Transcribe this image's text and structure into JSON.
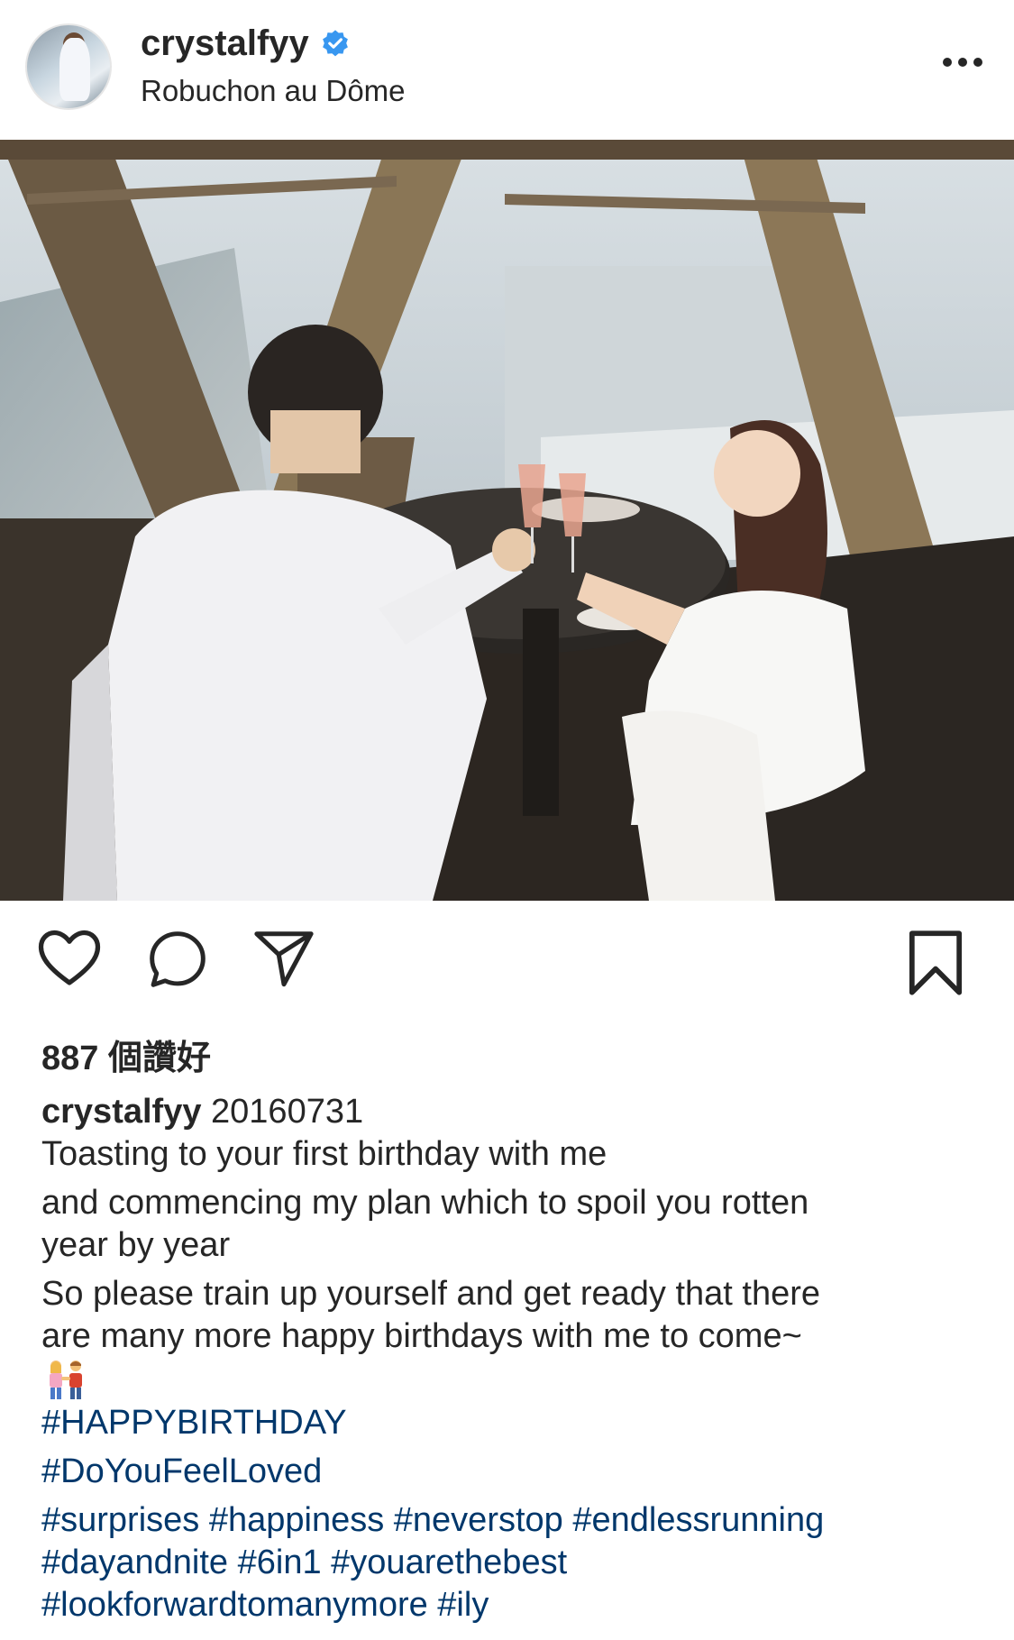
{
  "post": {
    "username": "crystalfyy",
    "location": "Robuchon au Dôme",
    "likes_text": "887 個讚好",
    "caption": {
      "username": "crystalfyy",
      "date": "20160731",
      "line1": "Toasting to your first birthday with me",
      "line2": "and commencing my plan which to spoil you rotten",
      "line3": "year by year",
      "line4": "So please train up yourself and get ready that there",
      "line5": "are many more happy birthdays with me to come~",
      "hashtags": {
        "row1": "#HAPPYBIRTHDAY",
        "row2": "#DoYouFeelLoved",
        "row3": "#surprises #happiness #neverstop #endlessrunning",
        "row4": "#dayandnite #6in1 #youarethebest",
        "row5": "#lookforwardtomanymore #ily"
      }
    }
  },
  "icons": {
    "verified": "verified-badge-icon",
    "more": "more-options-icon",
    "like": "heart-icon",
    "comment": "comment-icon",
    "share": "share-icon",
    "save": "bookmark-icon",
    "emoji": "couple-emoji"
  },
  "colors": {
    "verified": "#3897f0",
    "hashtag": "#00376b",
    "text": "#262626"
  }
}
